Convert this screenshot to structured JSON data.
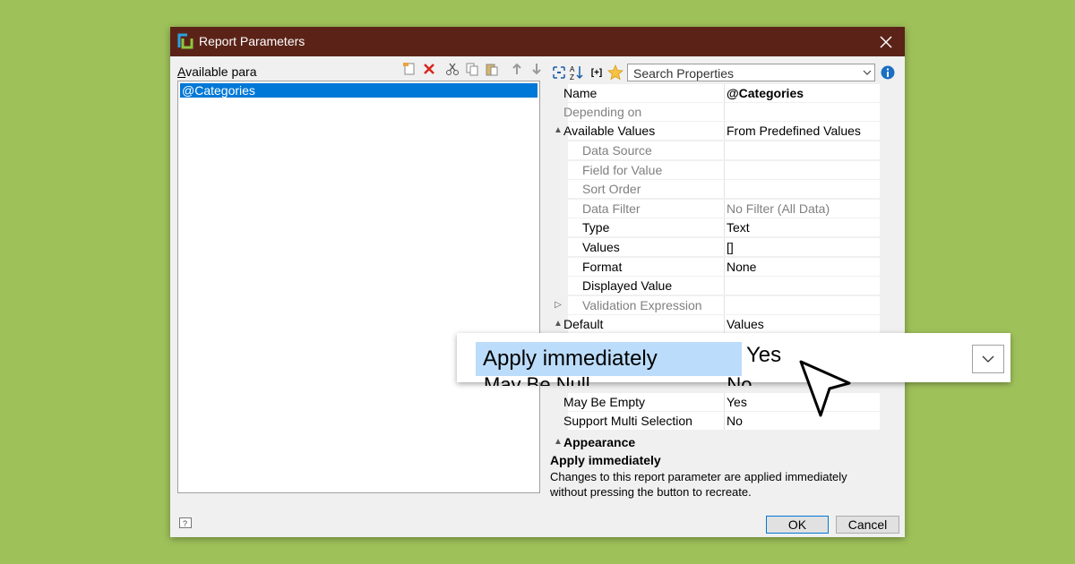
{
  "colors": {
    "background": "#9fc15a",
    "titlebar": "#5b2318",
    "selection": "#0078d7",
    "zoom_highlight": "#bbdcfa"
  },
  "window": {
    "title": "Report Parameters",
    "icon": "report-parameters-app-icon",
    "close_icon": "close-icon"
  },
  "left_panel": {
    "label_prefix": "A",
    "label_rest": "vailable para",
    "toolbar_icons": [
      "new-parameter-icon",
      "delete-icon",
      "cut-icon",
      "copy-icon",
      "paste-icon",
      "move-up-icon",
      "move-down-icon"
    ],
    "items": [
      {
        "label": "@Categories",
        "selected": true
      }
    ]
  },
  "right_panel": {
    "toolbar_icons": [
      "categorized-view-icon",
      "alphabetical-sort-icon",
      "expand-collapse-icon",
      "favorites-star-icon",
      "info-icon"
    ],
    "expand_label": "[+]",
    "search": {
      "placeholder": "Search Properties"
    },
    "properties": [
      {
        "name": "Name",
        "value": "@Categories",
        "indent": 0,
        "bold_value": true
      },
      {
        "name": "Depending on",
        "value": "",
        "indent": 0,
        "dim": true
      },
      {
        "name": "Available Values",
        "value": "From Predefined Values",
        "indent": 0,
        "expander": "▲"
      },
      {
        "name": "Data Source",
        "value": "",
        "indent": 1,
        "dim": true
      },
      {
        "name": "Field for Value",
        "value": "",
        "indent": 1,
        "dim": true
      },
      {
        "name": "Sort Order",
        "value": "",
        "indent": 1,
        "dim": true
      },
      {
        "name": "Data Filter",
        "value": "No Filter (All Data)",
        "indent": 1,
        "dim": true,
        "dim_value": true
      },
      {
        "name": "Type",
        "value": "Text",
        "indent": 1
      },
      {
        "name": "Values",
        "value": "[]",
        "indent": 1
      },
      {
        "name": "Format",
        "value": "None",
        "indent": 1
      },
      {
        "name": "Displayed Value",
        "value": "",
        "indent": 1
      },
      {
        "name": "Validation Expression",
        "value": "",
        "indent": 1,
        "dim": true,
        "expander": "▷"
      },
      {
        "name": "Default",
        "value": "Values",
        "indent": 0,
        "expander": "▲"
      },
      {
        "name": "May Be Empty",
        "value": "Yes",
        "indent": 0
      },
      {
        "name": "Support Multi Selection",
        "value": "No",
        "indent": 0
      },
      {
        "name": "Appearance",
        "value": "",
        "indent": 0,
        "group": true,
        "expander": "▲"
      }
    ],
    "description": {
      "title": "Apply immediately",
      "text": "Changes to this report parameter are applied immediately without pressing the button to recreate."
    }
  },
  "footer": {
    "help_icon": "help-icon",
    "ok_label": "OK",
    "cancel_label": "Cancel"
  },
  "zoom_callout": {
    "property_name": "Apply immediately",
    "property_value": "Yes",
    "dropdown_icon": "chevron-down-icon",
    "cursor_icon": "mouse-pointer-icon"
  }
}
